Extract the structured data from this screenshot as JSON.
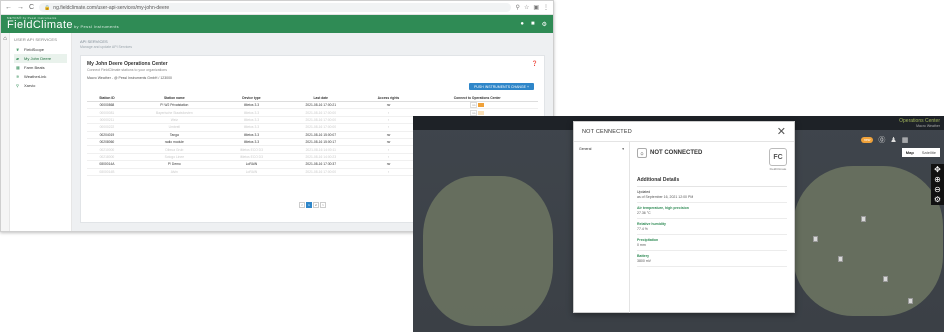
{
  "browser": {
    "url": "ng.fieldclimate.com/user-api-services/my-john-deere",
    "nav": [
      "←",
      "→",
      "C"
    ]
  },
  "app": {
    "brand_small": "METOS® by Pessl Instruments",
    "brand_name": "FieldClimate",
    "brand_suffix": "by Pessl Instruments"
  },
  "sidebar": {
    "header": "USER API SERVICES",
    "items": [
      {
        "label": "FieldScope",
        "icon": "leaf-icon"
      },
      {
        "label": "My John Deere",
        "icon": "tractor-icon",
        "active": true
      },
      {
        "label": "Farm Beats",
        "icon": "grid-icon"
      },
      {
        "label": "WeatherLink",
        "icon": "wifi-icon"
      },
      {
        "label": "Xarvio",
        "icon": "pin-icon"
      }
    ]
  },
  "breadcrumb": {
    "title": "API SERVICES",
    "subtitle": "Manage and update API Services"
  },
  "card": {
    "title": "My John Deere Operations Center",
    "subtitle": "Connect FieldClimate stations to your organizations",
    "info": "Macro Weather - @ Pessl Instruments GmbH / 123000",
    "add_button": "PUSH INSTRUMENTS CHANGE +",
    "remove_button": "REMOVE ACCESS"
  },
  "table": {
    "headers": [
      "Station ID",
      "Station name",
      "Device type",
      "Last date",
      "Access rights",
      "Connect to Operations Center"
    ],
    "rows": [
      {
        "id": "00000868",
        "name": "P! W2 Privatstation",
        "type": "iMetos 3.3",
        "date": "2021-08-16 17:00:21",
        "rights": "rw",
        "dim": false
      },
      {
        "id": "00000081",
        "name": "Bayerische Staatsforsten",
        "type": "iMetos 3.3",
        "date": "2021-08-16 17:00:00",
        "rights": "r",
        "dim": true
      },
      {
        "id": "00000211",
        "name": "Weiz",
        "type": "iMetos 3.3",
        "date": "2021-08-16 17:00:00",
        "rights": "r",
        "dim": true
      },
      {
        "id": "00000222",
        "name": "Umbrell",
        "type": "iMetos 3.3",
        "date": "2021-08-16 17:00:00",
        "rights": "r",
        "dim": true
      },
      {
        "id": "00204019",
        "name": "Tanga",
        "type": "iMetos 3.3",
        "date": "2021-08-16 15:00:07",
        "rights": "rw",
        "dim": false
      },
      {
        "id": "00208060",
        "name": "radio module",
        "type": "iMetos 3.3",
        "date": "2021-08-16 15:00:17",
        "rights": "rw",
        "dim": false
      },
      {
        "id": "00210000",
        "name": "Dibrua Grub",
        "type": "iMetos ECO D3",
        "date": "2021-08-16 14:00:11",
        "rights": "r",
        "dim": true
      },
      {
        "id": "00218000",
        "name": "Sotogo Linee",
        "type": "iMetos ECO D3",
        "date": "2021-08-16 14:00:23",
        "rights": "r",
        "dim": true
      },
      {
        "id": "0800014A",
        "name": "P! Demo",
        "type": "LoRAIN",
        "date": "2021-08-16 17:30:37",
        "rights": "rw",
        "dim": false
      },
      {
        "id": "0800014B",
        "name": "Alvin",
        "type": "LoRAIN",
        "date": "2021-08-16 17:00:00",
        "rights": "r",
        "dim": true
      }
    ],
    "connect_no": "no"
  },
  "pager": [
    "<",
    "1",
    "2",
    ">"
  ],
  "map": {
    "panel_title": "Operations Center",
    "panel_sub": "Macro Weather",
    "new_pill": "new",
    "maptype": [
      "Map",
      "Satellite"
    ]
  },
  "modal": {
    "title": "NOT CENNECTED",
    "left_tab": "General",
    "station_name": "NOT CONNECTED",
    "fc_label": "FieldClimate",
    "section": "Additional Details",
    "updated_label": "Updated",
    "updated_value": "as of September 16, 2021 12:00 PM",
    "details": [
      {
        "k": "Air temperature, high precision",
        "v": "27.36 °C"
      },
      {
        "k": "Relative humidity",
        "v": "77.4 %"
      },
      {
        "k": "Precipitation",
        "v": "0 mm"
      },
      {
        "k": "Battery",
        "v": "3800 mV"
      }
    ]
  }
}
